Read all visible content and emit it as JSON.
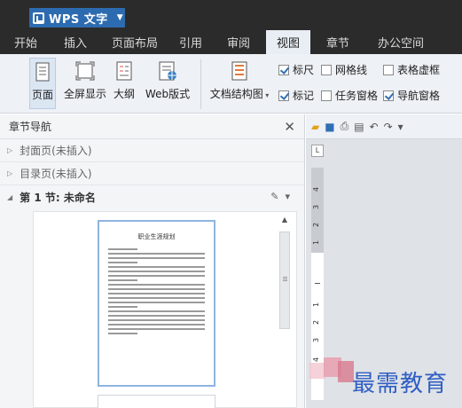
{
  "app": {
    "title": "WPS 文字"
  },
  "tabs": [
    "开始",
    "插入",
    "页面布局",
    "引用",
    "审阅",
    "视图",
    "章节",
    "办公空间"
  ],
  "active_tab": "视图",
  "ribbon": {
    "buttons": [
      {
        "label": "页面",
        "icon": "page-view-icon",
        "selected": true
      },
      {
        "label": "全屏显示",
        "icon": "fullscreen-icon",
        "selected": false
      },
      {
        "label": "大纲",
        "icon": "outline-icon",
        "selected": false
      },
      {
        "label": "Web版式",
        "icon": "web-layout-icon",
        "selected": false
      }
    ],
    "doc_structure": {
      "label": "文档结构图",
      "icon": "doc-structure-icon"
    },
    "checks": [
      {
        "label": "标尺",
        "checked": true
      },
      {
        "label": "网格线",
        "checked": false
      },
      {
        "label": "表格虚框",
        "checked": false
      },
      {
        "label": "标记",
        "checked": true
      },
      {
        "label": "任务窗格",
        "checked": false
      },
      {
        "label": "导航窗格",
        "checked": true
      }
    ]
  },
  "nav": {
    "title": "章节导航",
    "items": [
      {
        "label": "封面页(未插入)"
      },
      {
        "label": "目录页(未插入)"
      }
    ],
    "section": {
      "label": "第 1 节: 未命名"
    },
    "page_title": "职业生涯规划"
  },
  "watermark": {
    "text": "最需教育"
  },
  "colors": {
    "titlebar": "#2b2b2b",
    "accent": "#2d6bb0",
    "ribbon": "#eef1f5",
    "watermark": "#2f5fc4"
  }
}
